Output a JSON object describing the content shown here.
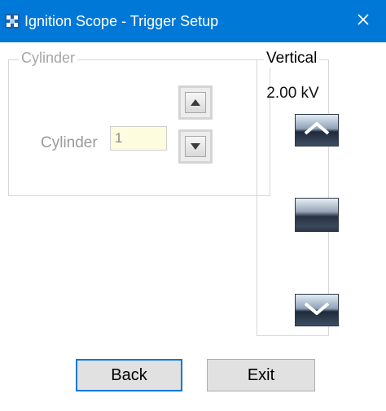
{
  "window": {
    "title": "Ignition Scope - Trigger Setup",
    "close_icon": "close-icon",
    "app_icon": "ignition-scope-app-icon",
    "titlebar_color": "#0078d7"
  },
  "cylinder_group": {
    "legend": "Cylinder",
    "field_label": "Cylinder",
    "field_value": "1",
    "increment_icon": "triangle-up-icon",
    "decrement_icon": "triangle-down-icon"
  },
  "vertical_group": {
    "legend": "Vertical",
    "readout": "2.00 kV",
    "scroll_up_icon": "chevron-up-icon",
    "scroll_down_icon": "chevron-down-icon"
  },
  "buttons": {
    "back_label": "Back",
    "exit_label": "Exit"
  },
  "colors": {
    "accent": "#0078d7",
    "input_bg": "#fefcdf"
  }
}
